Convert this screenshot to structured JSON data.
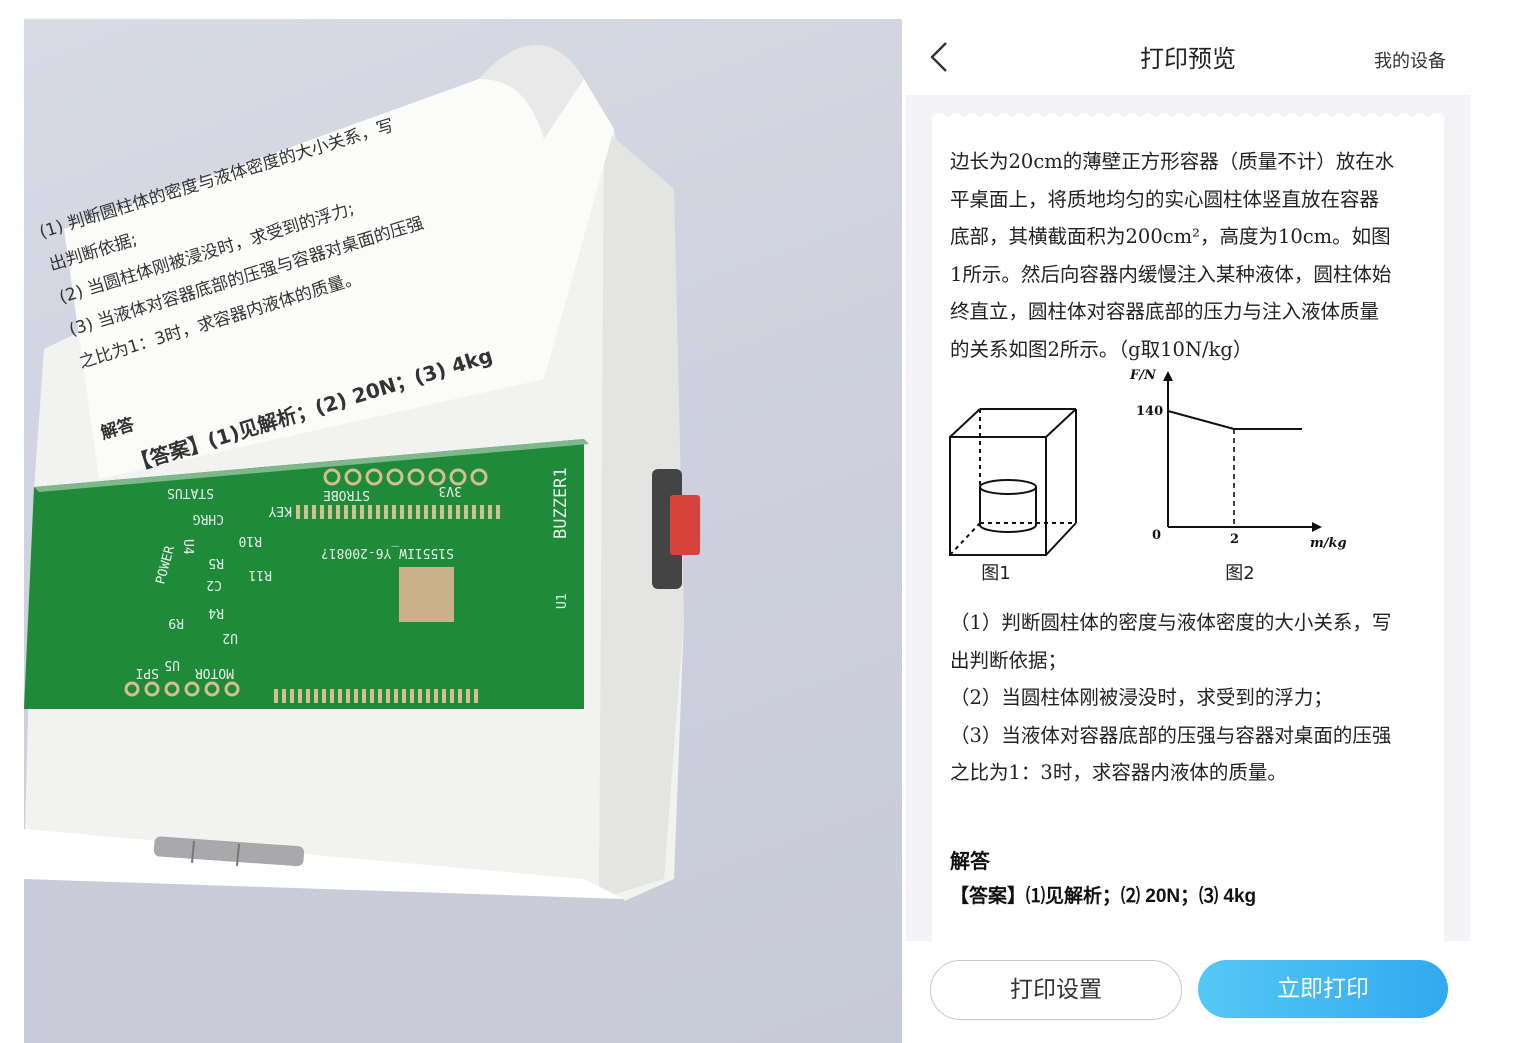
{
  "photo": {
    "paper_lines": [
      "(1) 判断圆柱体的密度与液体密度的大小关系，写",
      "出判断依据;",
      "(2) 当圆柱体刚被浸没时，求受到的浮力;",
      "(3) 当液体对容器底部的压强与容器对桌面的压强",
      "之比为1：3时，求容器内液体的质量。"
    ],
    "paper_answer_title": "解答",
    "paper_answer": "【答案】(1)见解析；(2) 20N；(3) 4kg",
    "pcb_labels": [
      "STATUS",
      "KEY",
      "STROBE",
      "3V3",
      "CHRG",
      "R10",
      "R11",
      "R5",
      "C2",
      "R4",
      "U4",
      "U2",
      "POWER",
      "R9",
      "U5",
      "MOTOR",
      "SPI",
      "BUZZER1",
      "U1",
      "S1551IW_Y6-20081?"
    ]
  },
  "header": {
    "title": "打印预览",
    "right_link": "我的设备"
  },
  "question": {
    "lines": [
      "边长为20cm的薄壁正方形容器（质量不计）放在水",
      "平桌面上，将质地均匀的实心圆柱体竖直放在容器",
      "底部，其横截面积为200cm²，高度为10cm。如图",
      "1所示。然后向容器内缓慢注入某种液体，圆柱体始",
      "终直立，圆柱体对容器底部的压力与注入液体质量",
      "的关系如图2所示。（g取10N/kg）"
    ],
    "sub_questions": [
      "（1）判断圆柱体的密度与液体密度的大小关系，写",
      "出判断依据；",
      "（2）当圆柱体刚被浸没时，求受到的浮力；",
      "（3）当液体对容器底部的压强与容器对桌面的压强",
      "之比为1：3时，求容器内液体的质量。"
    ],
    "figure1_caption": "图1",
    "figure2_caption": "图2",
    "fig2": {
      "y_axis_label": "F/N",
      "x_axis_label": "m/kg",
      "y_tick": "140",
      "x_tick": "2",
      "origin": "0"
    },
    "answer_title": "解答",
    "answer_text": "【答案】⑴见解析；⑵ 20N；⑶ 4kg"
  },
  "footer": {
    "settings_label": "打印设置",
    "print_label": "立即打印",
    "print_color": "#3db4f2"
  }
}
